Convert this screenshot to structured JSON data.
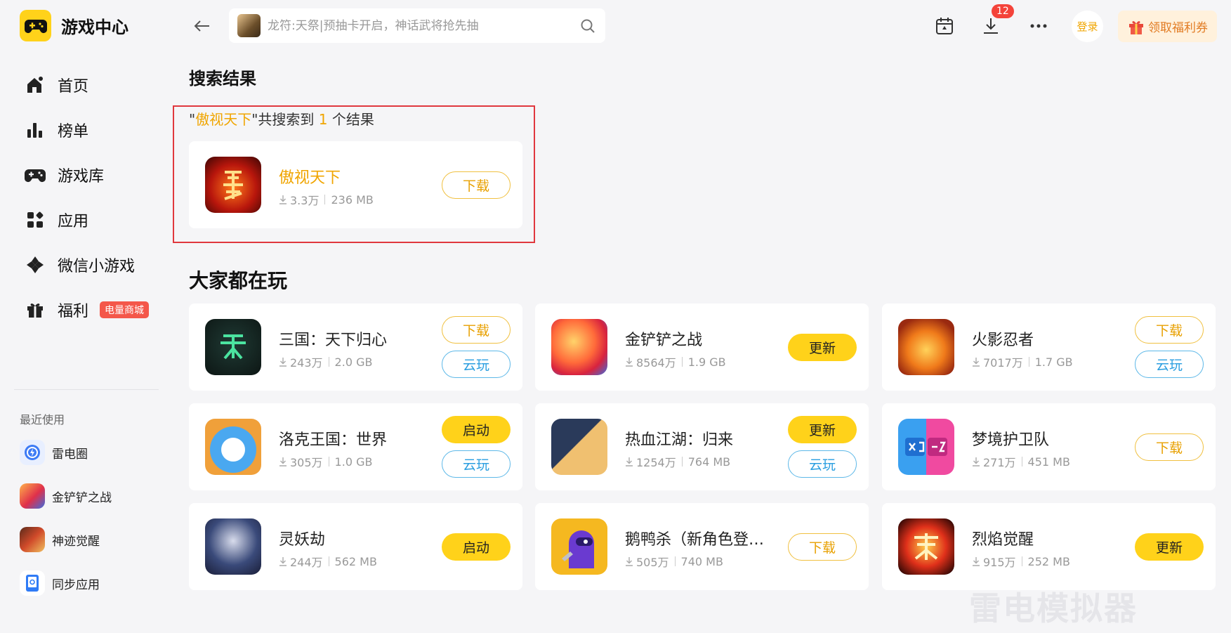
{
  "app": {
    "title": "游戏中心"
  },
  "sidebar": {
    "nav": [
      {
        "label": "首页",
        "icon": "home-icon"
      },
      {
        "label": "榜单",
        "icon": "ranking-icon"
      },
      {
        "label": "游戏库",
        "icon": "gamepad-icon"
      },
      {
        "label": "应用",
        "icon": "apps-icon"
      },
      {
        "label": "微信小游戏",
        "icon": "wechat-game-icon"
      },
      {
        "label": "福利",
        "icon": "gift-icon",
        "badge": "电量商城"
      }
    ],
    "recent_title": "最近使用",
    "recent": [
      {
        "label": "雷电圈"
      },
      {
        "label": "金铲铲之战"
      },
      {
        "label": "神迹觉醒"
      },
      {
        "label": "同步应用"
      }
    ]
  },
  "topbar": {
    "search_placeholder": "龙符:天祭|预抽卡开启，神话武将抢先抽",
    "download_count": "12",
    "login_label": "登录",
    "coupon_label": "领取福利券"
  },
  "search_results": {
    "title": "搜索结果",
    "query": "傲视天下",
    "summary_prefix": "\"",
    "summary_mid": "\"共搜索到 ",
    "count": "1",
    "summary_suffix": " 个结果",
    "items": [
      {
        "name": "傲视天下",
        "downloads": "3.3万",
        "size": "236 MB",
        "button": "下载"
      }
    ]
  },
  "popular": {
    "title": "大家都在玩",
    "items": [
      {
        "name": "三国：天下归心",
        "downloads": "243万",
        "size": "2.0 GB",
        "buttons": [
          "下载",
          "云玩"
        ]
      },
      {
        "name": "金铲铲之战",
        "downloads": "8564万",
        "size": "1.9 GB",
        "buttons": [
          "更新"
        ]
      },
      {
        "name": "火影忍者",
        "downloads": "7017万",
        "size": "1.7 GB",
        "buttons": [
          "下载",
          "云玩"
        ]
      },
      {
        "name": "洛克王国：世界",
        "downloads": "305万",
        "size": "1.0 GB",
        "buttons": [
          "启动",
          "云玩"
        ]
      },
      {
        "name": "热血江湖：归来",
        "downloads": "1254万",
        "size": "764 MB",
        "buttons": [
          "更新",
          "云玩"
        ]
      },
      {
        "name": "梦境护卫队",
        "downloads": "271万",
        "size": "451 MB",
        "buttons": [
          "下载"
        ]
      },
      {
        "name": "灵妖劫",
        "downloads": "244万",
        "size": "562 MB",
        "buttons": [
          "启动"
        ]
      },
      {
        "name": "鹅鸭杀（新角色登…",
        "downloads": "505万",
        "size": "740 MB",
        "buttons": [
          "下载"
        ]
      },
      {
        "name": "烈焰觉醒",
        "downloads": "915万",
        "size": "252 MB",
        "buttons": [
          "更新"
        ]
      }
    ]
  },
  "watermark": "雷电模拟器",
  "colors": {
    "accent": "#ffd21a",
    "highlight": "#f0a500",
    "cloud": "#2a9ee0",
    "badge": "#f4574a"
  }
}
